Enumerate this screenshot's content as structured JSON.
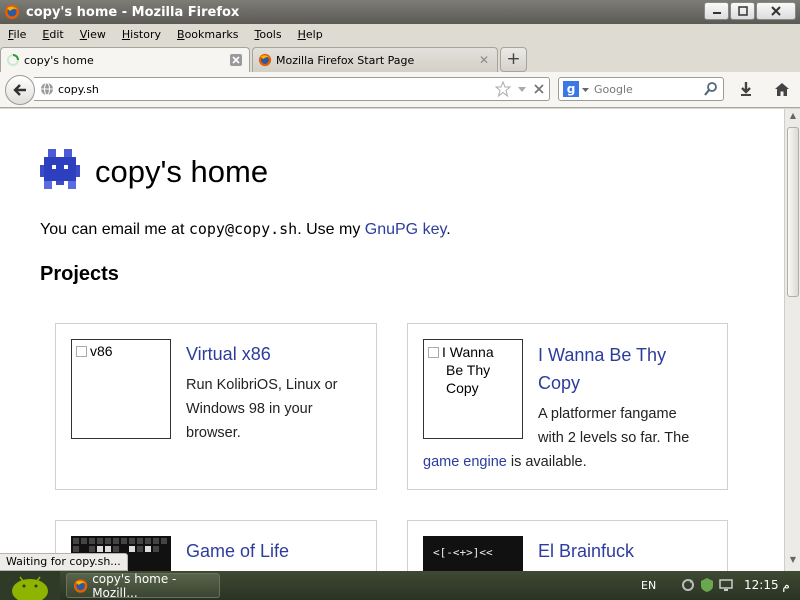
{
  "window": {
    "title": "copy's home - Mozilla Firefox",
    "buttons": {
      "minimize": "minimize",
      "maximize": "maximize",
      "close": "close"
    }
  },
  "menu": [
    "File",
    "Edit",
    "View",
    "History",
    "Bookmarks",
    "Tools",
    "Help"
  ],
  "tabs": [
    {
      "label": "copy's home",
      "state": "loading"
    },
    {
      "label": "Mozilla Firefox Start Page"
    }
  ],
  "nav": {
    "url": "copy.sh",
    "search_placeholder": "Google",
    "search_engine_letter": "g"
  },
  "page": {
    "title": "copy's home",
    "intro_prefix": "You can email me at ",
    "email": "copy@copy.sh",
    "intro_mid": ". Use my ",
    "gpg_link": "GnuPG key",
    "intro_suffix": ".",
    "projects_heading": "Projects",
    "projects": [
      {
        "thumb_alt": "v86",
        "title": "Virtual x86",
        "desc_lines": [
          "Run KolibriOS, Linux or",
          "Windows 98 in your",
          "browser."
        ]
      },
      {
        "thumb_alt_lines": [
          "I Wanna",
          "Be Thy",
          "Copy"
        ],
        "title_lines": [
          "I Wanna Be Thy",
          "Copy"
        ],
        "desc_lines": [
          "A platformer fangame",
          "with 2 levels so far. The"
        ],
        "desc_link": "game engine",
        "desc_tail": " is available."
      },
      {
        "title": "Game of Life"
      },
      {
        "thumb_text": "<[-<+>]<<",
        "title": "El Brainfuck"
      }
    ]
  },
  "status": "Waiting for copy.sh...",
  "taskbar": {
    "task_label": "copy's home - Mozill...",
    "lang": "EN",
    "clock": "12:15 م"
  },
  "colors": {
    "link": "#2c3d9c",
    "taskbar": "#3e4a33",
    "logo": "#2b3fbf"
  }
}
